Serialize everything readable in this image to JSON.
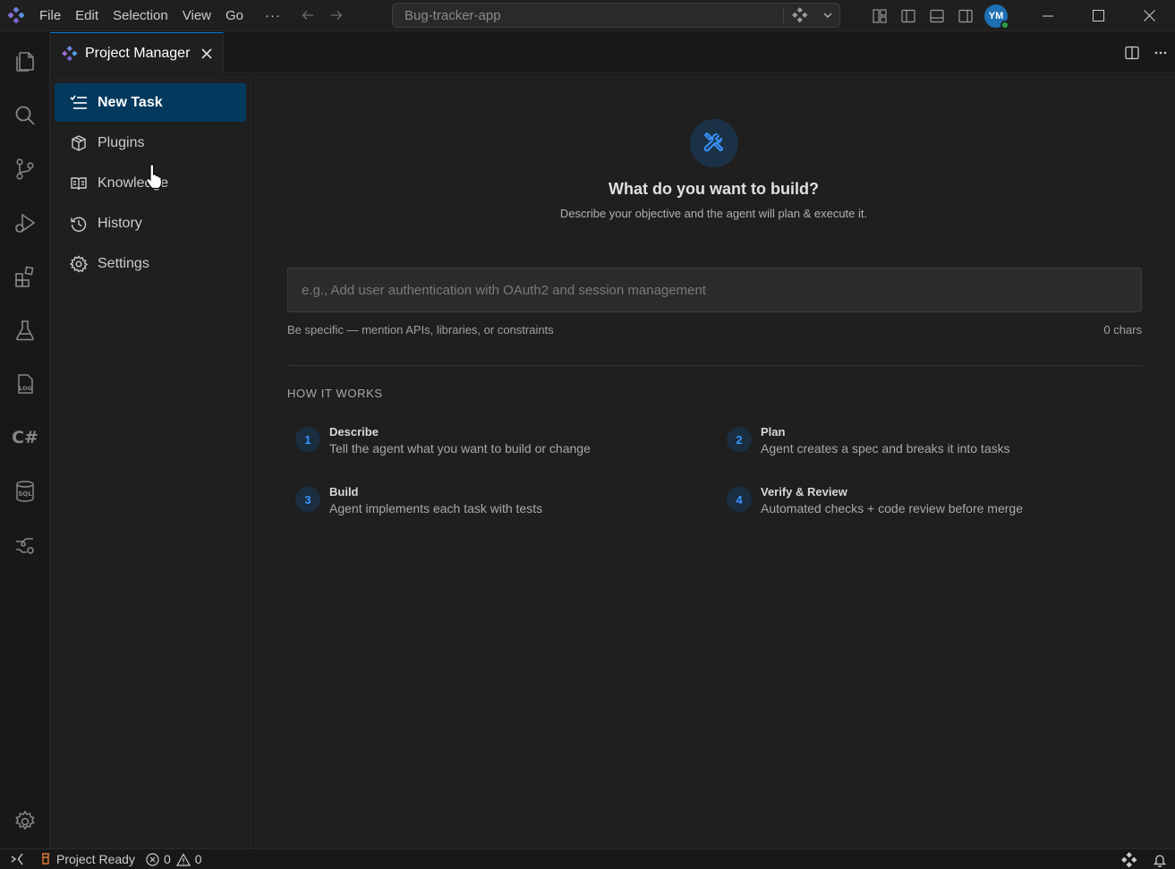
{
  "titlebar": {
    "menu": [
      "File",
      "Edit",
      "Selection",
      "View",
      "Go"
    ],
    "more": "···",
    "command_center": "Bug-tracker-app",
    "avatar_initials": "YM"
  },
  "tab": {
    "title": "Project Manager"
  },
  "sidebar": {
    "items": [
      {
        "label": "New Task",
        "icon": "new-task-icon",
        "active": true
      },
      {
        "label": "Plugins",
        "icon": "package-icon"
      },
      {
        "label": "Knowledge",
        "icon": "book-icon"
      },
      {
        "label": "History",
        "icon": "history-icon"
      },
      {
        "label": "Settings",
        "icon": "gear-icon"
      }
    ]
  },
  "main": {
    "title": "What do you want to build?",
    "subtitle": "Describe your objective and the agent will plan & execute it.",
    "input_placeholder": "e.g., Add user authentication with OAuth2 and session management",
    "input_value": "",
    "hint": "Be specific — mention APIs, libraries, or constraints",
    "char_count": "0 chars",
    "how_title": "HOW IT WORKS",
    "steps": [
      {
        "num": "1",
        "title": "Describe",
        "desc": "Tell the agent what you want to build or change"
      },
      {
        "num": "2",
        "title": "Plan",
        "desc": "Agent creates a spec and breaks it into tasks"
      },
      {
        "num": "3",
        "title": "Build",
        "desc": "Agent implements each task with tests"
      },
      {
        "num": "4",
        "title": "Verify & Review",
        "desc": "Automated checks + code review before merge"
      }
    ]
  },
  "statusbar": {
    "project_status": "Project Ready",
    "errors": "0",
    "warnings": "0"
  },
  "colors": {
    "accent": "#0078d4",
    "active_item_bg": "#04395e",
    "step_number": "#3794ff",
    "background": "#1f1f1f"
  }
}
